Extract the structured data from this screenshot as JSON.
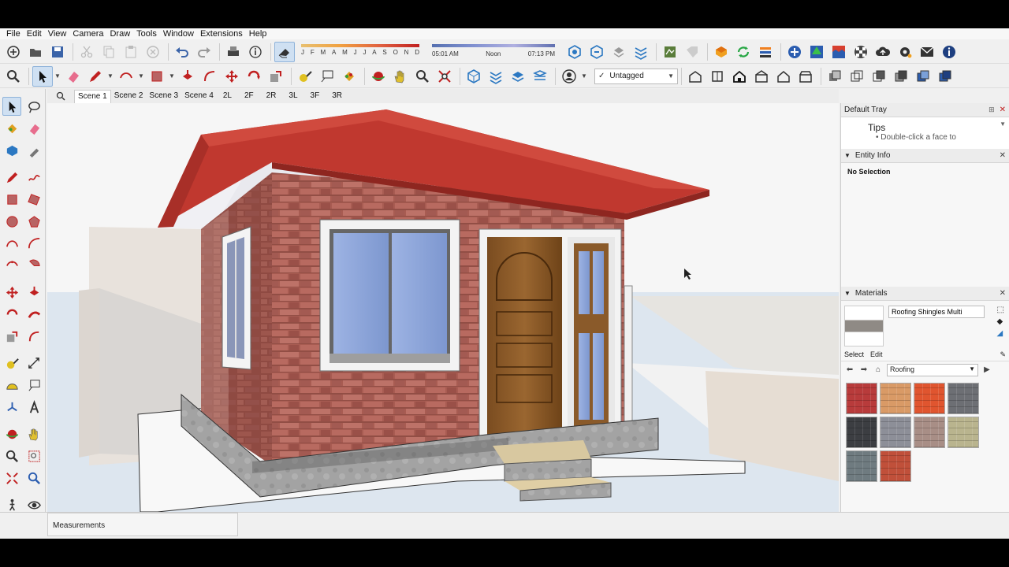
{
  "menu": [
    "File",
    "Edit",
    "View",
    "Camera",
    "Draw",
    "Tools",
    "Window",
    "Extensions",
    "Help"
  ],
  "shadow": {
    "months": [
      "J",
      "F",
      "M",
      "A",
      "M",
      "J",
      "J",
      "A",
      "S",
      "O",
      "N",
      "D"
    ],
    "time_start": "05:01 AM",
    "time_mid": "Noon",
    "time_end": "07:13 PM"
  },
  "tag": {
    "value": "Untagged"
  },
  "scenes": [
    "Scene 1",
    "Scene 2",
    "Scene 3",
    "Scene 4",
    "2L",
    "2F",
    "2R",
    "3L",
    "3F",
    "3R"
  ],
  "tray": {
    "title": "Default Tray",
    "tips": {
      "title": "Tips",
      "text": "• Double-click a face to"
    },
    "entity_info": {
      "title": "Entity Info",
      "status": "No Selection"
    },
    "materials": {
      "title": "Materials",
      "name": "Roofing Shingles Multi",
      "tab_select": "Select",
      "tab_edit": "Edit",
      "collection": "Roofing",
      "swatch_colors": [
        "#b83b3b",
        "#d99a66",
        "#e0552f",
        "#6d6f74",
        "#3c3e42",
        "#8d8f98",
        "#a88e86",
        "#b9b48e",
        "#6f7b80",
        "#c0503a"
      ]
    }
  },
  "status": {
    "measurements": "Measurements"
  },
  "colors": {
    "roof": "#c0382f",
    "brick": "#a85c52",
    "door": "#8a5a2a",
    "glass": "#8ea7d8",
    "concrete": "#a0a0a0"
  }
}
